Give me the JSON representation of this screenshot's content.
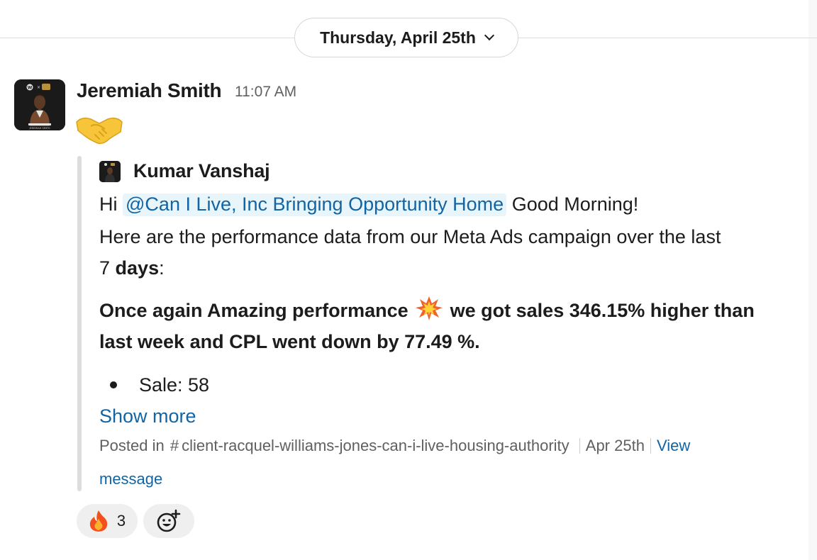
{
  "date_divider": {
    "label": "Thursday, April 25th",
    "icon": "chevron-down-icon"
  },
  "message": {
    "sender": "Jeremiah Smith",
    "time": "11:07 AM",
    "emoji": "handshake",
    "avatar_badge": "W",
    "avatar_caption": "JEREMIAH SMITH"
  },
  "shared": {
    "author": "Kumar Vanshaj",
    "greeting_prefix": "Hi",
    "mention": "@Can I Live, Inc Bringing Opportunity Home",
    "greeting_suffix": "Good Morning!",
    "line2": "Here are the performance data from our Meta Ads campaign over the last",
    "line3_num": "7",
    "line3_bold": "days",
    "line3_end": ":",
    "highlight_part1": "Once again Amazing performance",
    "highlight_part2": "we got sales 346.15% higher than",
    "highlight_line2": "last week and CPL went down by 77.49 %.",
    "bullet_item": "Sale: 58",
    "show_more": "Show more",
    "posted_in": "Posted in",
    "channel": "client-racquel-williams-jones-can-i-live-housing-authority",
    "date": "Apr 25th",
    "view_message_1": "View",
    "view_message_2": "message"
  },
  "reactions": [
    {
      "emoji": "fire",
      "count": "3"
    }
  ],
  "add_reaction_icon": "add-emoji-icon",
  "colors": {
    "link": "#1264a3",
    "mention_bg": "#e8f5fa",
    "muted": "#616061",
    "quote_bar": "#dddddd"
  }
}
